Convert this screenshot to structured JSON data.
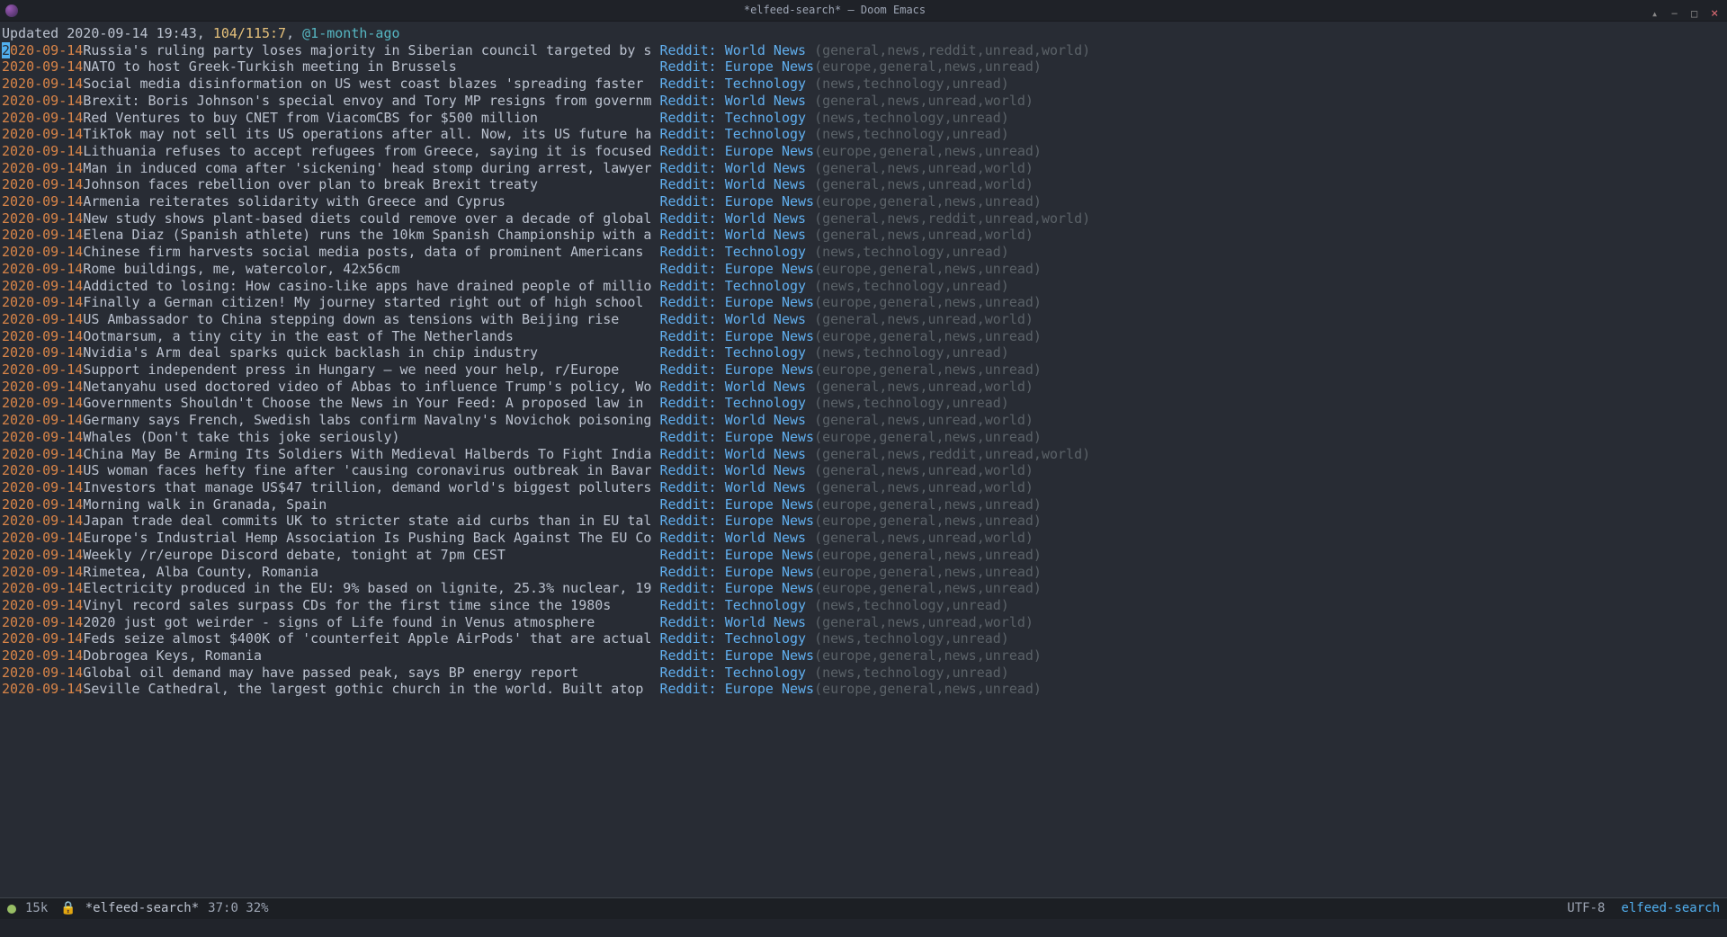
{
  "titlebar": {
    "title": "*elfeed-search* – Doom Emacs"
  },
  "header": {
    "prefix": "Updated ",
    "updated": "2020-09-14 19:43",
    "sep1": ", ",
    "count": "104/115:7",
    "sep2": ", ",
    "query": "@1-month-ago"
  },
  "feed_world": "Reddit: World News",
  "feed_europe": "Reddit: Europe News",
  "feed_tech": "Reddit: Technology",
  "tag_world": "(general,news,unread,world)",
  "tag_world_r": "(general,news,reddit,unread,world)",
  "tag_europe": "(europe,general,news,unread)",
  "tag_tech": "(news,technology,unread)",
  "entries": [
    {
      "date": "2020-09-14",
      "cursor": true,
      "title": "Russia's ruling party loses majority in Siberian council targeted by s",
      "feed": "world",
      "tags": "world_r"
    },
    {
      "date": "2020-09-14",
      "title": "NATO to host Greek-Turkish meeting in Brussels",
      "feed": "europe",
      "tags": "europe"
    },
    {
      "date": "2020-09-14",
      "title": "Social media disinformation on US west coast blazes 'spreading faster",
      "feed": "tech",
      "tags": "tech"
    },
    {
      "date": "2020-09-14",
      "title": "Brexit: Boris Johnson's special envoy and Tory MP resigns from governm",
      "feed": "world",
      "tags": "world"
    },
    {
      "date": "2020-09-14",
      "title": "Red Ventures to buy CNET from ViacomCBS for $500 million",
      "feed": "tech",
      "tags": "tech"
    },
    {
      "date": "2020-09-14",
      "title": "TikTok may not sell its US operations after all. Now, its US future ha",
      "feed": "tech",
      "tags": "tech"
    },
    {
      "date": "2020-09-14",
      "title": "Lithuania refuses to accept refugees from Greece, saying it is focused",
      "feed": "europe",
      "tags": "europe"
    },
    {
      "date": "2020-09-14",
      "title": "Man in induced coma after 'sickening' head stomp during arrest, lawyer",
      "feed": "world",
      "tags": "world"
    },
    {
      "date": "2020-09-14",
      "title": "Johnson faces rebellion over plan to break Brexit treaty",
      "feed": "world",
      "tags": "world"
    },
    {
      "date": "2020-09-14",
      "title": "Armenia reiterates solidarity with Greece and Cyprus",
      "feed": "europe",
      "tags": "europe"
    },
    {
      "date": "2020-09-14",
      "title": "New study shows plant-based diets could remove over a decade of global",
      "feed": "world",
      "tags": "world_r"
    },
    {
      "date": "2020-09-14",
      "title": "Elena Diaz (Spanish athlete) runs the 10km Spanish Championship with a",
      "feed": "world",
      "tags": "world"
    },
    {
      "date": "2020-09-14",
      "title": "Chinese firm harvests social media posts, data of prominent Americans",
      "feed": "tech",
      "tags": "tech"
    },
    {
      "date": "2020-09-14",
      "title": "Rome buildings, me, watercolor, 42x56cm",
      "feed": "europe",
      "tags": "europe"
    },
    {
      "date": "2020-09-14",
      "title": "Addicted to losing: How casino-like apps have drained people of millio",
      "feed": "tech",
      "tags": "tech"
    },
    {
      "date": "2020-09-14",
      "title": "Finally a German citizen! My journey started right out of high school",
      "feed": "europe",
      "tags": "europe"
    },
    {
      "date": "2020-09-14",
      "title": "US Ambassador to China stepping down as tensions with Beijing rise",
      "feed": "world",
      "tags": "world"
    },
    {
      "date": "2020-09-14",
      "title": "Ootmarsum, a tiny city in the east of The Netherlands",
      "feed": "europe",
      "tags": "europe"
    },
    {
      "date": "2020-09-14",
      "title": "Nvidia's Arm deal sparks quick backlash in chip industry",
      "feed": "tech",
      "tags": "tech"
    },
    {
      "date": "2020-09-14",
      "title": "Support independent press in Hungary – we need your help, r/Europe",
      "feed": "europe",
      "tags": "europe"
    },
    {
      "date": "2020-09-14",
      "title": "Netanyahu used doctored video of Abbas to influence Trump's policy, Wo",
      "feed": "world",
      "tags": "world"
    },
    {
      "date": "2020-09-14",
      "title": "Governments Shouldn't Choose the News in Your Feed: A proposed law in",
      "feed": "tech",
      "tags": "tech"
    },
    {
      "date": "2020-09-14",
      "title": "Germany says French, Swedish labs confirm Navalny's Novichok poisoning",
      "feed": "world",
      "tags": "world"
    },
    {
      "date": "2020-09-14",
      "title": "Whales (Don't take this joke seriously)",
      "feed": "europe",
      "tags": "europe"
    },
    {
      "date": "2020-09-14",
      "title": "China May Be Arming Its Soldiers With Medieval Halberds To Fight India",
      "feed": "world",
      "tags": "world_r"
    },
    {
      "date": "2020-09-14",
      "title": "US woman faces hefty fine after 'causing coronavirus outbreak in Bavar",
      "feed": "world",
      "tags": "world"
    },
    {
      "date": "2020-09-14",
      "title": "Investors that manage US$47 trillion, demand world's biggest polluters",
      "feed": "world",
      "tags": "world"
    },
    {
      "date": "2020-09-14",
      "title": "Morning walk in Granada, Spain",
      "feed": "europe",
      "tags": "europe"
    },
    {
      "date": "2020-09-14",
      "title": "Japan trade deal commits UK to stricter state aid curbs than in EU tal",
      "feed": "europe",
      "tags": "europe"
    },
    {
      "date": "2020-09-14",
      "title": "Europe's Industrial Hemp Association Is Pushing Back Against The EU Co",
      "feed": "world",
      "tags": "world"
    },
    {
      "date": "2020-09-14",
      "title": "Weekly /r/europe Discord debate, tonight at 7pm CEST",
      "feed": "europe",
      "tags": "europe"
    },
    {
      "date": "2020-09-14",
      "title": "Rimetea, Alba County, Romania",
      "feed": "europe",
      "tags": "europe"
    },
    {
      "date": "2020-09-14",
      "title": "Electricity produced in the EU: 9% based on lignite, 25.3% nuclear, 19",
      "feed": "europe",
      "tags": "europe"
    },
    {
      "date": "2020-09-14",
      "title": "Vinyl record sales surpass CDs for the first time since the 1980s",
      "feed": "tech",
      "tags": "tech"
    },
    {
      "date": "2020-09-14",
      "title": "2020 just got weirder - signs of Life found in Venus atmosphere",
      "feed": "world",
      "tags": "world"
    },
    {
      "date": "2020-09-14",
      "title": "Feds seize almost $400K of 'counterfeit Apple AirPods' that are actual",
      "feed": "tech",
      "tags": "tech"
    },
    {
      "date": "2020-09-14",
      "title": "Dobrogea Keys, Romania",
      "feed": "europe",
      "tags": "europe"
    },
    {
      "date": "2020-09-14",
      "title": "Global oil demand may have passed peak, says BP energy report",
      "feed": "tech",
      "tags": "tech"
    },
    {
      "date": "2020-09-14",
      "title": "Seville Cathedral, the largest gothic church in the world. Built atop",
      "feed": "europe",
      "tags": "europe"
    }
  ],
  "modeline": {
    "size": "15k",
    "lock": "🔒",
    "buffer": "*elfeed-search*",
    "pos": "37:0 32%",
    "encoding": "UTF-8",
    "mode": "elfeed-search"
  }
}
